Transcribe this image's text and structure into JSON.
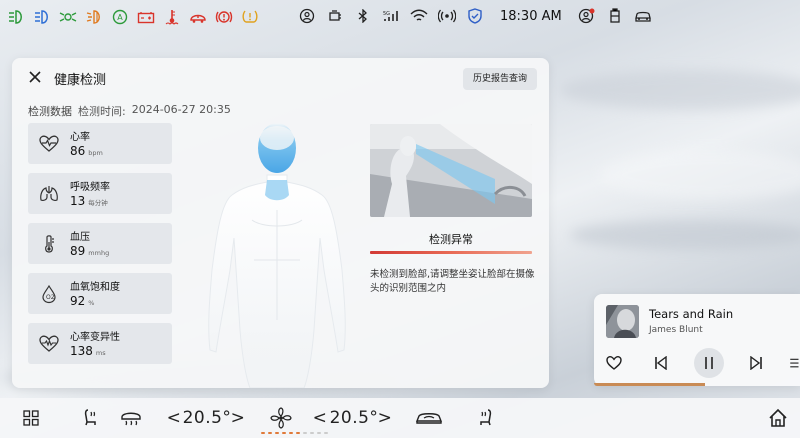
{
  "status_bar": {
    "time": "18:30 AM",
    "warning_icons": [
      {
        "name": "headlight-icon",
        "color": "#2c9a3a"
      },
      {
        "name": "high-beam-icon",
        "color": "#2f6fd6"
      },
      {
        "name": "side-light-icon",
        "color": "#2c9a3a"
      },
      {
        "name": "fog-light-icon",
        "color": "#e07a1f"
      },
      {
        "name": "auto-hold-icon",
        "color": "#2c9a3a"
      },
      {
        "name": "battery-icon",
        "color": "#d9342b"
      },
      {
        "name": "engine-temp-icon",
        "color": "#d9342b"
      },
      {
        "name": "vehicle-fault-icon",
        "color": "#d9342b"
      },
      {
        "name": "brake-warning-icon",
        "color": "#d9342b"
      },
      {
        "name": "tire-pressure-icon",
        "color": "#e0a21f"
      }
    ],
    "system_icons": [
      "driver-monitor-icon",
      "seatbelt-icon",
      "bluetooth-icon",
      "signal-icon",
      "wifi-icon",
      "hotspot-icon",
      "security-shield-icon"
    ],
    "right_icons": [
      "user-account-icon",
      "door-icon",
      "car-icon"
    ]
  },
  "health": {
    "title": "健康检测",
    "history_button": "历史报告查询",
    "data_label": "检测数据",
    "time_label": "检测时间:",
    "time_value": "2024-06-27 20:35",
    "metrics": [
      {
        "icon": "heart-rate-icon",
        "label": "心率",
        "value": "86",
        "unit": "bpm"
      },
      {
        "icon": "lungs-icon",
        "label": "呼吸频率",
        "value": "13",
        "unit": "每分钟"
      },
      {
        "icon": "thermometer-icon",
        "label": "血压",
        "value": "89",
        "unit": "mmhg"
      },
      {
        "icon": "oxygen-drop-icon",
        "label": "血氧饱和度",
        "value": "92",
        "unit": "%"
      },
      {
        "icon": "heart-variability-icon",
        "label": "心率变异性",
        "value": "138",
        "unit": "ms"
      }
    ],
    "detect_title": "检测异常",
    "detect_message": "未检测到脸部,请调整坐姿让脸部在摄像头的识别范围之内",
    "alert_color": "#d9342b"
  },
  "music": {
    "song": "Tears and Rain",
    "artist": "James Blunt",
    "progress": 0.54,
    "progress_color": "#c98b55"
  },
  "dock": {
    "left_temp": "20.5°",
    "right_temp": "20.5°",
    "left_arrow_prev": "<",
    "left_arrow_next": ">",
    "right_arrow_prev": "<",
    "right_arrow_next": ">",
    "fan_level": 0.6,
    "fan_color": "#e07a3a"
  }
}
